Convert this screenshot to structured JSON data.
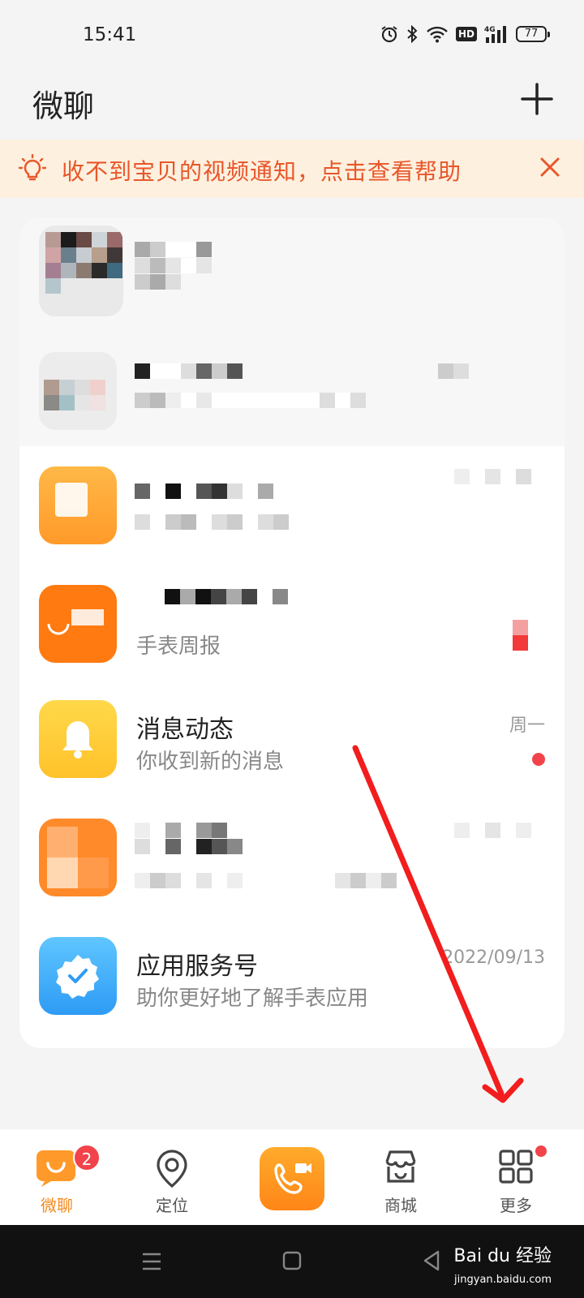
{
  "status_bar": {
    "time": "15:41",
    "hd": "HD",
    "network": "4G",
    "battery": "77",
    "icons": [
      "alarm-icon",
      "bluetooth-icon",
      "wifi-icon",
      "hd-icon",
      "signal-icon",
      "battery-icon"
    ]
  },
  "header": {
    "title": "微聊",
    "add_icon": "plus-icon"
  },
  "notice": {
    "text": "收不到宝贝的视频通知，点击查看帮助",
    "color": "#e8572a",
    "background": "#fdf0df",
    "icon": "lightbulb-icon",
    "close_icon": "close-icon"
  },
  "messages": [
    {
      "title": "",
      "subtitle": "",
      "time": "",
      "blurred": true
    },
    {
      "title": "",
      "subtitle": "",
      "time": "",
      "blurred": true
    },
    {
      "title": "",
      "subtitle": "",
      "time": "",
      "blurred": true
    },
    {
      "title": "",
      "subtitle": "手表周报",
      "time": "",
      "blurred": true
    },
    {
      "title": "消息动态",
      "subtitle": "你收到新的消息",
      "time": "周一",
      "unread": true,
      "icon": "bell-icon"
    },
    {
      "title": "",
      "subtitle": "",
      "time": "",
      "blurred": true
    },
    {
      "title": "应用服务号",
      "subtitle": "助你更好地了解手表应用",
      "time": "2022/09/13",
      "icon": "verified-badge-icon"
    }
  ],
  "bottom_nav": {
    "items": [
      {
        "label": "微聊",
        "icon": "chat-icon",
        "badge": "2",
        "active": true
      },
      {
        "label": "定位",
        "icon": "location-pin-icon"
      },
      {
        "label": "",
        "icon": "video-call-icon"
      },
      {
        "label": "商城",
        "icon": "store-icon"
      },
      {
        "label": "更多",
        "icon": "grid-icon",
        "dot": true
      }
    ],
    "active_color": "#f5891f"
  },
  "watermark": {
    "text": "Bai du 经验",
    "sub": "jingyan.baidu.com"
  },
  "colors": {
    "accent_orange": "#f5891f",
    "badge_red": "#f2434b",
    "annotation_arrow": "#f21d1d"
  }
}
